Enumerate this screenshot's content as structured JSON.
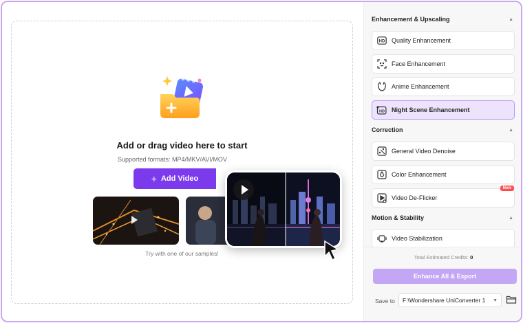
{
  "dropzone": {
    "title": "Add or drag video here to start",
    "formats": "Supported formats: MP4/MKV/AVI/MOV",
    "add_button": "Add Video",
    "samples_hint": "Try with one of our samples!"
  },
  "panel": {
    "sections": [
      {
        "title": "Enhancement & Upscaling",
        "items": [
          {
            "label": "Quality Enhancement",
            "icon": "hd-icon"
          },
          {
            "label": "Face Enhancement",
            "icon": "face-scan-icon"
          },
          {
            "label": "Anime Enhancement",
            "icon": "anime-face-icon"
          },
          {
            "label": "Night Scene Enhancement",
            "icon": "hd-night-icon",
            "selected": true
          }
        ]
      },
      {
        "title": "Correction",
        "items": [
          {
            "label": "General Video Denoise",
            "icon": "denoise-icon"
          },
          {
            "label": "Color Enhancement",
            "icon": "color-icon"
          },
          {
            "label": "Video De-Flicker",
            "icon": "deflicker-icon",
            "badge": "New"
          }
        ]
      },
      {
        "title": "Motion & Stability",
        "items": [
          {
            "label": "Video Stabilization",
            "icon": "stabilization-icon"
          }
        ]
      }
    ],
    "credits_label": "Total Estimated Credits:",
    "credits_value": "0",
    "export_button": "Enhance All & Export",
    "save_to_label": "Save to",
    "save_to_value": "F:\\Wondershare UniConverter 1"
  },
  "colors": {
    "accent": "#7c3aed",
    "selected_bg": "#ede3fd",
    "export_disabled": "#c3a7f5",
    "frame_border": "#c9a6f2"
  }
}
